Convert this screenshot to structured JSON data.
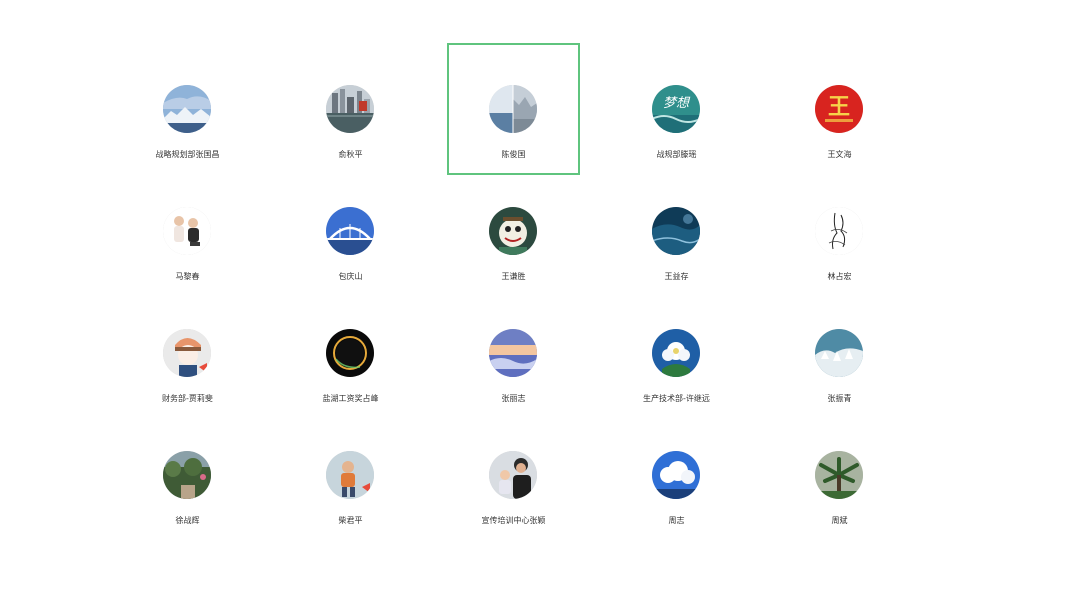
{
  "selected_index": 2,
  "contacts": [
    {
      "name": "战略规划部张国昌",
      "icon": "mountain-lake-avatar-icon"
    },
    {
      "name": "俞秋平",
      "icon": "city-harbor-avatar-icon"
    },
    {
      "name": "陈俊国",
      "icon": "split-sea-avatar-icon"
    },
    {
      "name": "战规部滕瑶",
      "icon": "calligraphy-teal-avatar-icon"
    },
    {
      "name": "王文海",
      "icon": "red-wang-character-avatar-icon"
    },
    {
      "name": "马黎春",
      "icon": "kids-photo-avatar-icon"
    },
    {
      "name": "包庆山",
      "icon": "white-bridge-avatar-icon"
    },
    {
      "name": "王谦胜",
      "icon": "cartoon-cat-avatar-icon"
    },
    {
      "name": "王益存",
      "icon": "dark-ocean-avatar-icon"
    },
    {
      "name": "林占宏",
      "icon": "ink-sketch-avatar-icon"
    },
    {
      "name": "财务部-贾莉斐",
      "icon": "cartoon-girl-avatar-icon"
    },
    {
      "name": "盐湖工资奖占峰",
      "icon": "eclipse-ring-avatar-icon"
    },
    {
      "name": "张丽志",
      "icon": "sunset-clouds-avatar-icon"
    },
    {
      "name": "生产技术部-许继远",
      "icon": "white-flower-avatar-icon"
    },
    {
      "name": "张振青",
      "icon": "snowy-trees-avatar-icon"
    },
    {
      "name": "徐战辉",
      "icon": "garden-path-avatar-icon"
    },
    {
      "name": "柴君平",
      "icon": "child-photo-avatar-icon"
    },
    {
      "name": "宣传培训中心张颖",
      "icon": "family-photo-avatar-icon"
    },
    {
      "name": "周志",
      "icon": "blue-sky-clouds-avatar-icon"
    },
    {
      "name": "周斌",
      "icon": "palm-tree-avatar-icon"
    }
  ],
  "avatar_text": {
    "calligraphy": "梦想",
    "wang": "王"
  },
  "colors": {
    "selection_border": "#5fc47e",
    "name_text": "#333333",
    "background": "#ffffff"
  }
}
